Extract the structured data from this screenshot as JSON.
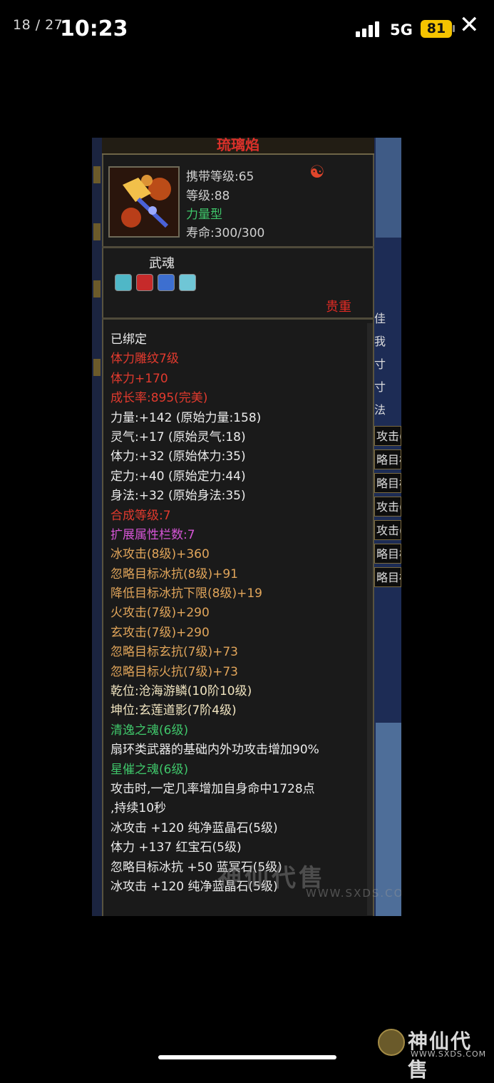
{
  "status_bar": {
    "counter": "18 / 27",
    "time": "10:23",
    "network": "5G",
    "battery": "81"
  },
  "item": {
    "name": "琉璃焰",
    "carry_level": "携带等级:65",
    "level": "等级:88",
    "type": "力量型",
    "lifespan": "寿命:300/300",
    "soul_label": "武魂",
    "rarity": "贵重"
  },
  "gems": [
    {
      "name": "teal-gem",
      "color": "#4fb7c7"
    },
    {
      "name": "red-gem",
      "color": "#c62a2a"
    },
    {
      "name": "blue-gem",
      "color": "#3d6fd0"
    },
    {
      "name": "teal-gem",
      "color": "#6fc6d6"
    }
  ],
  "stat_lines": [
    {
      "text": "已绑定",
      "color": "white"
    },
    {
      "text": "体力雕纹7级",
      "color": "red"
    },
    {
      "text": "体力+170",
      "color": "red"
    },
    {
      "text": "成长率:895(完美)",
      "color": "red"
    },
    {
      "text": "力量:+142 (原始力量:158)",
      "color": "white"
    },
    {
      "text": "灵气:+17 (原始灵气:18)",
      "color": "white"
    },
    {
      "text": "体力:+32 (原始体力:35)",
      "color": "white"
    },
    {
      "text": "定力:+40 (原始定力:44)",
      "color": "white"
    },
    {
      "text": "身法:+32 (原始身法:35)",
      "color": "white"
    },
    {
      "text": "合成等级:7",
      "color": "red"
    },
    {
      "text": "扩展属性栏数:7",
      "color": "purple"
    },
    {
      "text": "冰攻击(8级)+360",
      "color": "orange"
    },
    {
      "text": "忽略目标冰抗(8级)+91",
      "color": "orange"
    },
    {
      "text": "降低目标冰抗下限(8级)+19",
      "color": "orange"
    },
    {
      "text": "火攻击(7级)+290",
      "color": "orange"
    },
    {
      "text": "玄攻击(7级)+290",
      "color": "orange"
    },
    {
      "text": "忽略目标玄抗(7级)+73",
      "color": "orange"
    },
    {
      "text": "忽略目标火抗(7级)+73",
      "color": "orange"
    },
    {
      "text": "乾位:沧海游鳞(10阶10级)",
      "color": "cream"
    },
    {
      "text": "坤位:玄莲道影(7阶4级)",
      "color": "cream"
    },
    {
      "text": "清逸之魂(6级)",
      "color": "green"
    },
    {
      "text": "扇环类武器的基础内外功攻击增加90%",
      "color": "white"
    },
    {
      "text": "星催之魂(6级)",
      "color": "green"
    },
    {
      "text": "攻击时,一定几率增加自身命中1728点",
      "color": "white"
    },
    {
      "text": ",持续10秒",
      "color": "white"
    },
    {
      "text": "冰攻击 +120 纯净蓝晶石(5级)",
      "color": "white"
    },
    {
      "text": "体力 +137 红宝石(5级)",
      "color": "white"
    },
    {
      "text": "忽略目标冰抗 +50 蓝冥石(5级)",
      "color": "white"
    },
    {
      "text": "冰攻击 +120 纯净蓝晶石(5级)",
      "color": "white"
    }
  ],
  "right_side": {
    "chars": [
      "佳",
      "我",
      "寸",
      "寸",
      "法"
    ],
    "buttons": [
      "攻击(",
      "略目标",
      "略目标",
      "攻击(",
      "攻击(",
      "略目标",
      "略目标"
    ]
  },
  "watermark": {
    "text": "神仙代售",
    "url": "WWW.SXDS.COM"
  },
  "brand": {
    "name": "神仙代售",
    "url": "WWW.SXDS.COM"
  }
}
